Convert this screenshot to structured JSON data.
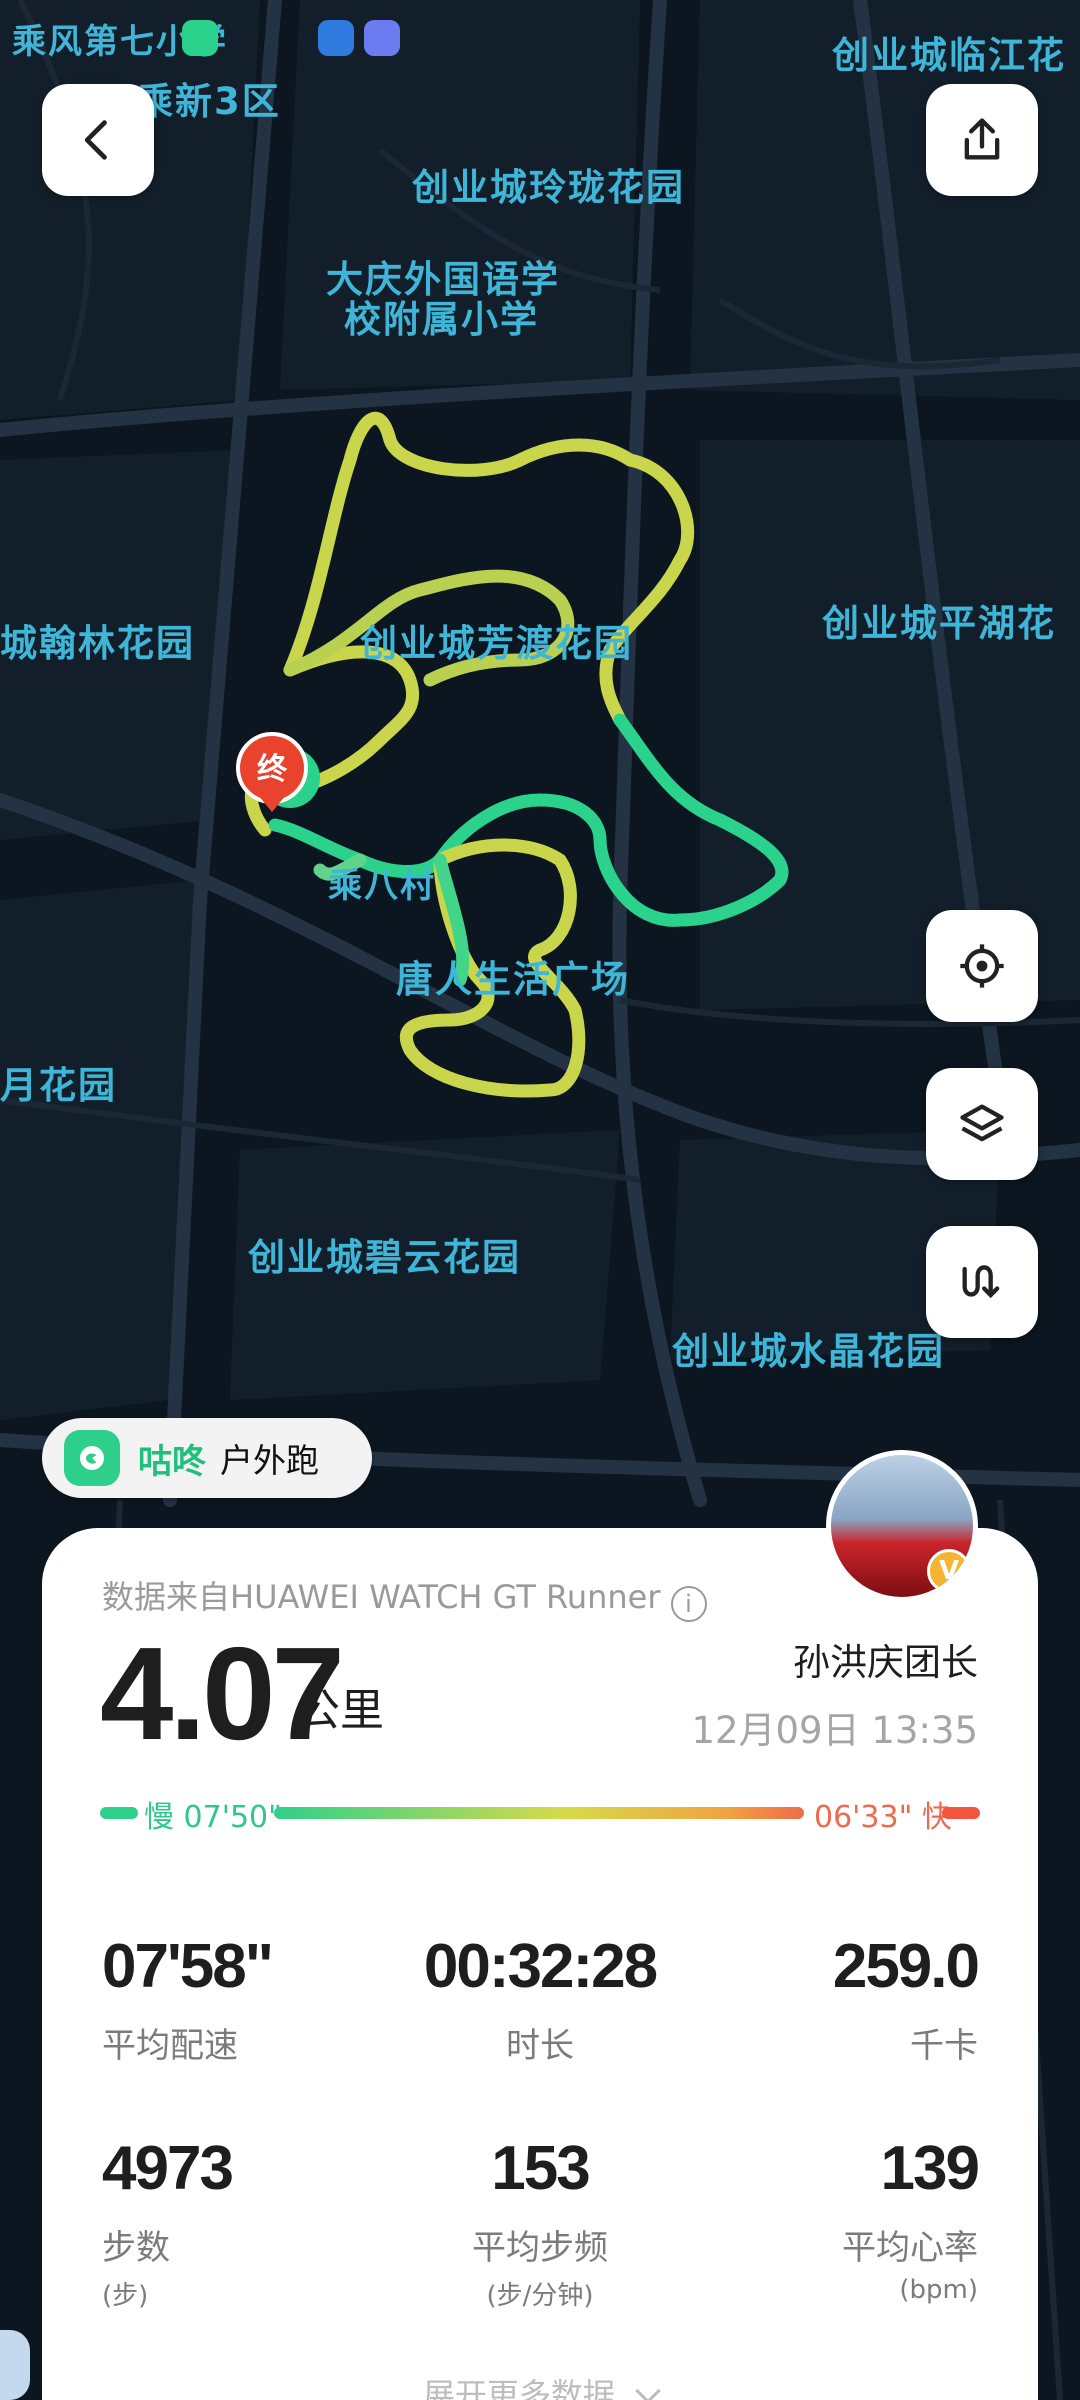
{
  "map": {
    "labels": [
      {
        "id": "l1",
        "text": "乘风第七小学"
      },
      {
        "id": "l2",
        "text": "乘新3区"
      },
      {
        "id": "l3",
        "text": "创业城临江花"
      },
      {
        "id": "l4",
        "text": "创业城玲珑花园"
      },
      {
        "id": "l5",
        "text": "大庆外国语学"
      },
      {
        "id": "l6",
        "text": "校附属小学"
      },
      {
        "id": "l7",
        "text": "城翰林花园"
      },
      {
        "id": "l8",
        "text": "创业城芳渡花园"
      },
      {
        "id": "l9",
        "text": "创业城平湖花"
      },
      {
        "id": "l10",
        "text": "乘八村"
      },
      {
        "id": "l11",
        "text": "唐人生活广场"
      },
      {
        "id": "l12",
        "text": "月花园"
      },
      {
        "id": "l13",
        "text": "创业城碧云花园"
      },
      {
        "id": "l14",
        "text": "创业城水晶花园"
      }
    ],
    "end_marker": "终",
    "route_colors": {
      "fast": "#2bd28c",
      "slow": "#c9d54a"
    }
  },
  "app": {
    "brand": "咕咚",
    "mode": "户外跑"
  },
  "summary": {
    "source": "数据来自HUAWEI WATCH GT Runner",
    "info_icon": "i",
    "distance": "4.07",
    "distance_unit": "公里",
    "leader": "孙洪庆团长",
    "datetime": "12月09日 13:35",
    "avatar_badge": "V"
  },
  "pace_legend": {
    "slow": "慢 07'50\"",
    "fast": "06'33\" 快",
    "slow_color": "#2fd08b",
    "fast_color": "#f2553f"
  },
  "stats": [
    {
      "value": "07'58\"",
      "label": "平均配速",
      "sub": ""
    },
    {
      "value": "00:32:28",
      "label": "时长",
      "sub": ""
    },
    {
      "value": "259.0",
      "label": "千卡",
      "sub": ""
    },
    {
      "value": "4973",
      "label": "步数",
      "sub": "(步)"
    },
    {
      "value": "153",
      "label": "平均步频",
      "sub": "(步/分钟)"
    },
    {
      "value": "139",
      "label": "平均心率",
      "sub": "(bpm)"
    }
  ],
  "expand_label": "展开更多数据"
}
